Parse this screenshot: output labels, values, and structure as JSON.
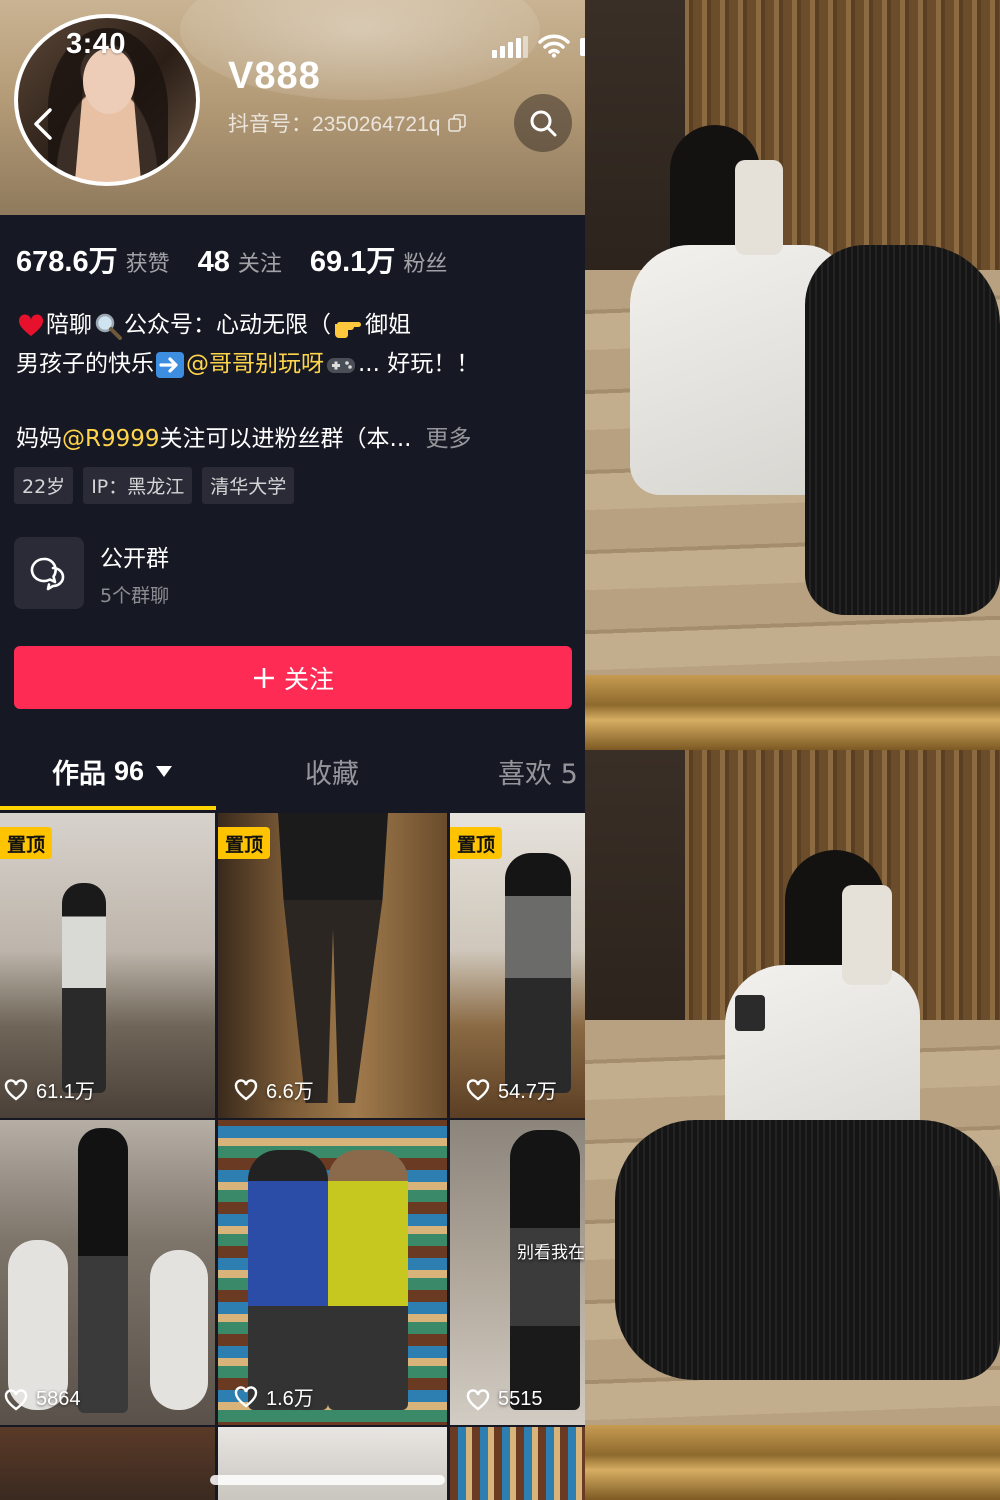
{
  "status_bar": {
    "time": "3:40"
  },
  "profile": {
    "username": "V888",
    "douyin_id": "抖音号：2350264721q"
  },
  "stats": [
    {
      "value": "678.6万",
      "label": "获赞"
    },
    {
      "value": "48",
      "label": "关注"
    },
    {
      "value": "69.1万",
      "label": "粉丝"
    }
  ],
  "bio": {
    "line1_a": "陪聊",
    "line1_b": "公众号：心动无限（",
    "line1_c": "御姐",
    "line2_a": "男孩子的快乐",
    "line2_mention": "@哥哥别玩呀",
    "line2_b": "... 好玩！！",
    "line3_a": "妈妈 ",
    "line3_mention": "@R9999",
    "line3_b": " 关注可以进粉丝群（本...",
    "more": "更多"
  },
  "tags": [
    "22岁",
    "IP：黑龙江",
    "清华大学"
  ],
  "group": {
    "title": "公开群",
    "subtitle": "5个群聊"
  },
  "follow_button": "关注",
  "tabs": {
    "works_label": "作品",
    "works_count": "96",
    "favorites": "收藏",
    "likes": "喜欢 5"
  },
  "videos": [
    {
      "pinned": true,
      "pin_label": "置顶",
      "likes": "61.1万"
    },
    {
      "pinned": true,
      "pin_label": "置顶",
      "likes": "6.6万"
    },
    {
      "pinned": true,
      "pin_label": "置顶",
      "likes": "54.7万"
    },
    {
      "pinned": false,
      "likes": "5864"
    },
    {
      "pinned": false,
      "likes": "1.6万"
    },
    {
      "pinned": false,
      "likes": "5515",
      "overlay": "别看我在"
    }
  ],
  "colors": {
    "follow": "#fe2c55",
    "pin": "#ffc300",
    "mention": "#ffd54a",
    "tab_indicator": "#ffd400"
  }
}
